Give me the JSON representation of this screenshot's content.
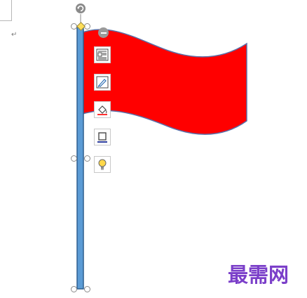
{
  "document": {
    "paragraph_mark": "↵"
  },
  "shape": {
    "name": "red-flag",
    "flag_color": "#ff0000",
    "flag_outline": "#5a6fa8",
    "pole_color": "#5b9bd5",
    "pole_outline": "#2e5e8f"
  },
  "layout_options": {
    "items": [
      {
        "icon": "layout-options-icon"
      },
      {
        "icon": "shape-style-icon"
      },
      {
        "icon": "shape-fill-icon"
      },
      {
        "icon": "shape-outline-icon"
      },
      {
        "icon": "shape-effects-icon"
      }
    ]
  },
  "watermark": {
    "text": "最需网",
    "color": "#7b3fc9"
  }
}
